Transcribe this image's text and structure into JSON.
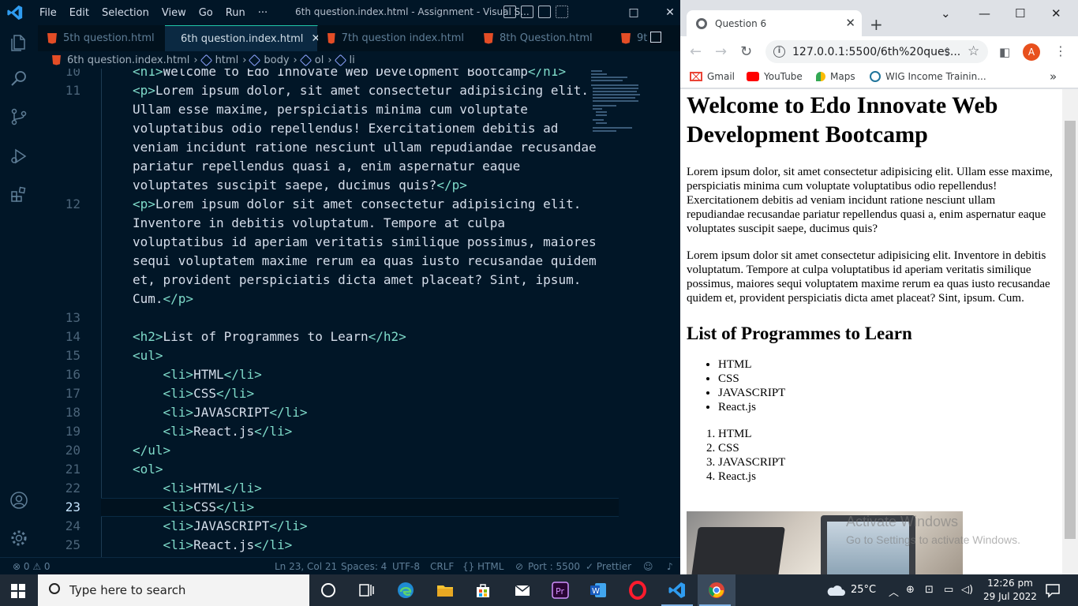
{
  "vscode": {
    "menu": [
      "File",
      "Edit",
      "Selection",
      "View",
      "Go",
      "Run",
      "···"
    ],
    "title": "6th question.index.html - Assignment - Visual S...",
    "tabs": [
      {
        "label": "5th question.html",
        "active": false
      },
      {
        "label": "6th question.index.html",
        "active": true
      },
      {
        "label": "7th question index.html",
        "active": false
      },
      {
        "label": "8th Question.html",
        "active": false
      },
      {
        "label": "9t",
        "active": false
      }
    ],
    "breadcrumbs": [
      "6th question.index.html",
      "html",
      "body",
      "ol",
      "li"
    ],
    "code": [
      {
        "n": "10",
        "text": "<h1>Welcome to Edo Innovate Web Development Bootcamp</h1>"
      },
      {
        "n": "11",
        "text": "<p>Lorem ipsum dolor, sit amet consectetur adipisicing elit."
      },
      {
        "n": "",
        "text": "Ullam esse maxime, perspiciatis minima cum voluptate"
      },
      {
        "n": "",
        "text": "voluptatibus odio repellendus! Exercitationem debitis ad"
      },
      {
        "n": "",
        "text": "veniam incidunt ratione nesciunt ullam repudiandae recusandae"
      },
      {
        "n": "",
        "text": "pariatur repellendus quasi a, enim aspernatur eaque"
      },
      {
        "n": "",
        "text": "voluptates suscipit saepe, ducimus quis?</p>"
      },
      {
        "n": "12",
        "text": "<p>Lorem ipsum dolor sit amet consectetur adipisicing elit."
      },
      {
        "n": "",
        "text": "Inventore in debitis voluptatum. Tempore at culpa"
      },
      {
        "n": "",
        "text": "voluptatibus id aperiam veritatis similique possimus, maiores"
      },
      {
        "n": "",
        "text": "sequi voluptatem maxime rerum ea quas iusto recusandae quidem"
      },
      {
        "n": "",
        "text": "et, provident perspiciatis dicta amet placeat? Sint, ipsum."
      },
      {
        "n": "",
        "text": "Cum.</p>"
      },
      {
        "n": "13",
        "text": ""
      },
      {
        "n": "14",
        "text": "<h2>List of Programmes to Learn</h2>"
      },
      {
        "n": "15",
        "text": "<ul>"
      },
      {
        "n": "16",
        "text": "    <li>HTML</li>"
      },
      {
        "n": "17",
        "text": "    <li>CSS</li>"
      },
      {
        "n": "18",
        "text": "    <li>JAVASCRIPT</li>"
      },
      {
        "n": "19",
        "text": "    <li>React.js</li>"
      },
      {
        "n": "20",
        "text": "</ul>"
      },
      {
        "n": "21",
        "text": "<ol>"
      },
      {
        "n": "22",
        "text": "    <li>HTML</li>"
      },
      {
        "n": "23",
        "text": "    <li>CSS</li>"
      },
      {
        "n": "24",
        "text": "    <li>JAVASCRIPT</li>"
      },
      {
        "n": "25",
        "text": "    <li>React.js</li>"
      }
    ],
    "current_line": "23",
    "status": {
      "problems": "⊗ 0 ⚠ 0",
      "position": "Ln 23, Col 21",
      "spaces": "Spaces: 4",
      "encoding": "UTF-8",
      "eol": "CRLF",
      "language": "HTML",
      "port": "Port : 5500",
      "prettier": "✓ Prettier"
    }
  },
  "chrome": {
    "tab_title": "Question 6",
    "url": "127.0.0.1:5500/6th%20ques...",
    "avatar_letter": "A",
    "bookmarks": [
      "Gmail",
      "YouTube",
      "Maps",
      "WIG Income Trainin..."
    ],
    "page": {
      "h1": "Welcome to Edo Innovate Web Development Bootcamp",
      "p1": "Lorem ipsum dolor, sit amet consectetur adipisicing elit. Ullam esse maxime, perspiciatis minima cum voluptate voluptatibus odio repellendus! Exercitationem debitis ad veniam incidunt ratione nesciunt ullam repudiandae recusandae pariatur repellendus quasi a, enim aspernatur eaque voluptates suscipit saepe, ducimus quis?",
      "p2": "Lorem ipsum dolor sit amet consectetur adipisicing elit. Inventore in debitis voluptatum. Tempore at culpa voluptatibus id aperiam veritatis similique possimus, maiores sequi voluptatem maxime rerum ea quas iusto recusandae quidem et, provident perspiciatis dicta amet placeat? Sint, ipsum. Cum.",
      "h2": "List of Programmes to Learn",
      "ul": [
        "HTML",
        "CSS",
        "JAVASCRIPT",
        "React.js"
      ],
      "ol": [
        "HTML",
        "CSS",
        "JAVASCRIPT",
        "React.js"
      ]
    },
    "watermark": {
      "line1": "Activate Windows",
      "line2": "Go to Settings to activate Windows."
    }
  },
  "taskbar": {
    "search_placeholder": "Type here to search",
    "weather": "25°C",
    "time": "12:26 pm",
    "date": "29 Jul 2022"
  },
  "colors": {
    "editor_bg": "#011627",
    "tag_color": "#7fdbca",
    "active_tab_border": "#21c7a8",
    "taskbar_bg": "#1f2a36"
  }
}
